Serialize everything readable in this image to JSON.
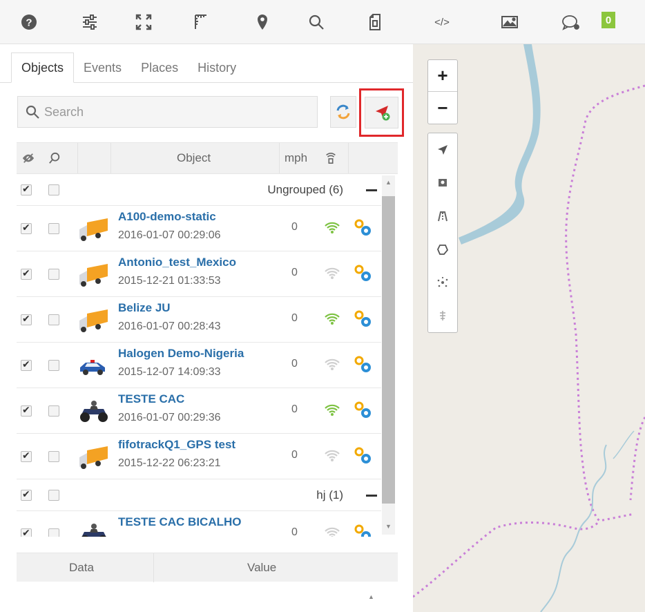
{
  "toolbar": {
    "icons": [
      "help-icon",
      "settings-sliders-icon",
      "fullscreen-icon",
      "ruler-icon",
      "marker-icon",
      "search-icon",
      "document-icon",
      "code-icon",
      "image-icon",
      "chat-icon"
    ],
    "code_label": "</>",
    "message_count": "0"
  },
  "tabs": [
    "Objects",
    "Events",
    "Places",
    "History"
  ],
  "search": {
    "placeholder": "Search"
  },
  "table_header": {
    "object": "Object",
    "speed": "mph"
  },
  "groups": [
    {
      "name": "Ungrouped (6)",
      "objects": [
        {
          "name": "A100-demo-static",
          "time": "2016-01-07 00:29:06",
          "speed": "0",
          "signal": "online",
          "vehicle": "truck"
        },
        {
          "name": "Antonio_test_Mexico",
          "time": "2015-12-21 01:33:53",
          "speed": "0",
          "signal": "offline",
          "vehicle": "truck"
        },
        {
          "name": "Belize JU",
          "time": "2016-01-07 00:28:43",
          "speed": "0",
          "signal": "online",
          "vehicle": "truck"
        },
        {
          "name": "Halogen Demo-Nigeria",
          "time": "2015-12-07 14:09:33",
          "speed": "0",
          "signal": "offline",
          "vehicle": "police-car"
        },
        {
          "name": "TESTE CAC",
          "time": "2016-01-07 00:29:36",
          "speed": "0",
          "signal": "online",
          "vehicle": "atv"
        },
        {
          "name": "fifotrackQ1_GPS test",
          "time": "2015-12-22 06:23:21",
          "speed": "0",
          "signal": "offline",
          "vehicle": "truck"
        }
      ]
    },
    {
      "name": "hj (1)",
      "objects": [
        {
          "name": "TESTE CAC BICALHO",
          "time": "",
          "speed": "0",
          "signal": "offline",
          "vehicle": "atv"
        }
      ]
    }
  ],
  "details_header": {
    "data": "Data",
    "value": "Value"
  },
  "map": {
    "zoom_in": "+",
    "zoom_out": "−",
    "tools": [
      "navigate-icon",
      "street-view-icon",
      "traffic-icon",
      "polygon-icon",
      "cluster-icon",
      "pin-icon"
    ]
  },
  "colors": {
    "accent_blue": "#2a6fa9",
    "online_green": "#7dc242",
    "highlight_red": "#e0282b",
    "badge_green": "#8cc63e"
  }
}
